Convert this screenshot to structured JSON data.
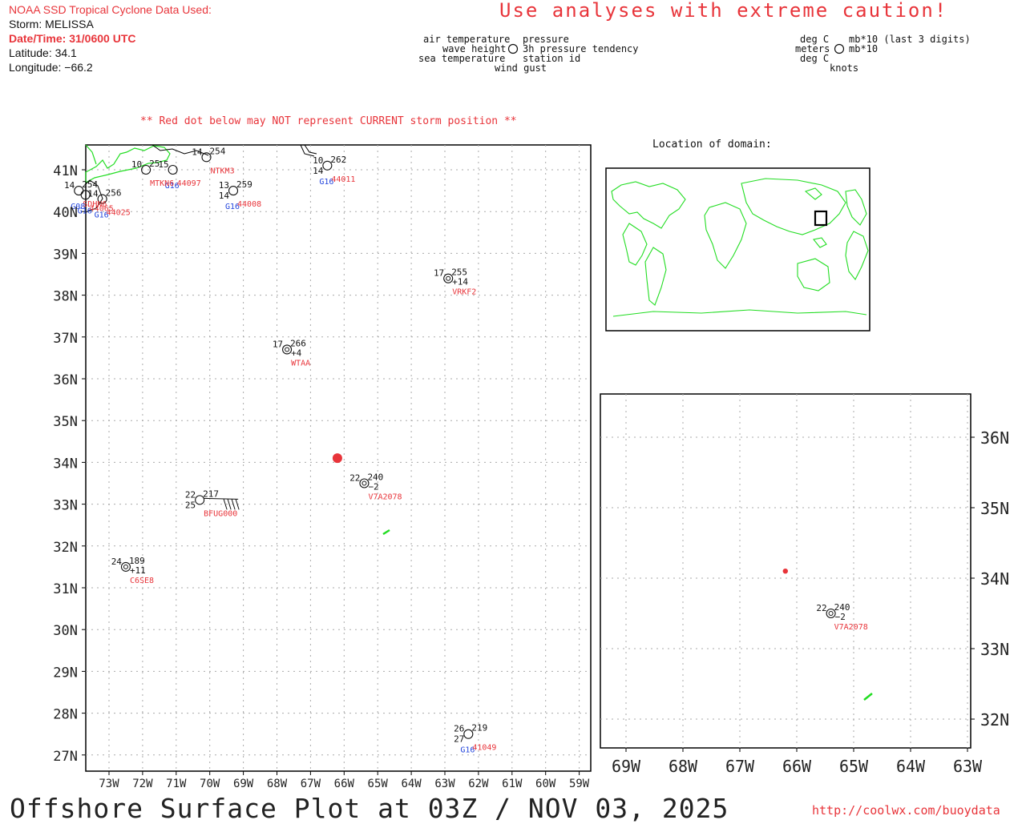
{
  "header": {
    "source_label": "NOAA SSD Tropical Cyclone Data Used:",
    "storm": "Storm: MELISSA",
    "datetime": "Date/Time: 31/0600 UTC",
    "latitude": "Latitude: 34.1",
    "longitude": "Longitude: −66.2"
  },
  "caution": "Use analyses with extreme caution!",
  "legend": {
    "left": [
      "air temperature",
      "wave height",
      "sea temperature"
    ],
    "right": [
      "pressure",
      "3h pressure tendency",
      "station id"
    ],
    "bottom": "wind gust",
    "units_left": [
      "deg C",
      "meters",
      "deg C"
    ],
    "units_right": [
      "mb*10 (last 3 digits)",
      "mb*10"
    ],
    "units_bottom": "knots"
  },
  "warning": "** Red dot below may NOT represent CURRENT storm position **",
  "location_title": "Location of domain:",
  "footer": {
    "title": "Offshore Surface Plot at 03Z / NOV 03, 2025",
    "url": "http://coolwx.com/buoydata"
  },
  "colors": {
    "storm": "#e8343a",
    "land": "#22dd22",
    "station_id": "#e8343a",
    "sensor_blue": "#2244dd",
    "grid": "#aaaaaa"
  },
  "main_map": {
    "lat_labels": [
      "41N",
      "40N",
      "39N",
      "38N",
      "37N",
      "36N",
      "35N",
      "34N",
      "33N",
      "32N",
      "31N",
      "30N",
      "29N",
      "28N",
      "27N"
    ],
    "lon_labels": [
      "73W",
      "72W",
      "71W",
      "70W",
      "69W",
      "68W",
      "67W",
      "66W",
      "65W",
      "64W",
      "63W",
      "62W",
      "61W",
      "60W",
      "59W"
    ],
    "storm_position": {
      "lat": 34.1,
      "lon": -66.2
    },
    "stations": [
      {
        "id": "VRKF2",
        "lon": -62.9,
        "lat": 38.4,
        "air": "17",
        "pres": "255",
        "tend": "+14"
      },
      {
        "id": "WTAA",
        "lon": -67.7,
        "lat": 36.7,
        "air": "17",
        "pres": "266",
        "tend": "+4"
      },
      {
        "id": "V7A2078",
        "lon": -65.4,
        "lat": 33.5,
        "air": "22",
        "pres": "240",
        "tend": "−2"
      },
      {
        "id": "BFUG000",
        "lon": -70.3,
        "lat": 33.1,
        "air": "22",
        "pres": "217",
        "sst": "25"
      },
      {
        "id": "C6SE8",
        "lon": -72.5,
        "lat": 31.5,
        "air": "24",
        "pres": "189",
        "tend": "+11"
      },
      {
        "id": "41049",
        "lon": -62.3,
        "lat": 27.5,
        "air": "26",
        "pres": "219",
        "sst": "27",
        "sensor": "G16"
      },
      {
        "id": "44011",
        "lon": -66.5,
        "lat": 41.1,
        "air": "10",
        "pres": "262",
        "sst": "14",
        "sensor": "G16"
      },
      {
        "id": "44008",
        "lon": -69.3,
        "lat": 40.5,
        "air": "13",
        "pres": "259",
        "sst": "14",
        "sensor": "G16"
      },
      {
        "id": "44097",
        "lon": -71.1,
        "lat": 41.0,
        "air": "15",
        "pres": "",
        "sst": "",
        "sensor": "G16"
      },
      {
        "id": "MTKN6",
        "lon": -71.9,
        "lat": 41.0,
        "air": "10",
        "pres": "25",
        "sst": ""
      },
      {
        "id": "NTKM3",
        "lon": -70.1,
        "lat": 41.3,
        "air": "14",
        "pres": "254",
        "sst": ""
      },
      {
        "id": "44025",
        "lon": -73.2,
        "lat": 40.3,
        "air": "14",
        "pres": "256",
        "sst": "",
        "sensor": "G16"
      },
      {
        "id": "44065",
        "lon": -73.7,
        "lat": 40.4,
        "air": "",
        "pres": "",
        "sst": "",
        "sensor": "G16"
      },
      {
        "id": "SDHN6",
        "lon": -73.9,
        "lat": 40.5,
        "air": "14",
        "pres": "254",
        "sst": "",
        "sensor": "G08"
      }
    ]
  },
  "inset_map": {
    "lat_labels": [
      "36N",
      "35N",
      "34N",
      "33N",
      "32N"
    ],
    "lon_labels": [
      "69W",
      "68W",
      "67W",
      "66W",
      "65W",
      "64W",
      "63W"
    ],
    "storm_position": {
      "lat": 34.1,
      "lon": -66.2
    },
    "stations": [
      {
        "id": "V7A2078",
        "lon": -65.4,
        "lat": 33.5,
        "air": "22",
        "pres": "240",
        "tend": "−2"
      }
    ]
  }
}
